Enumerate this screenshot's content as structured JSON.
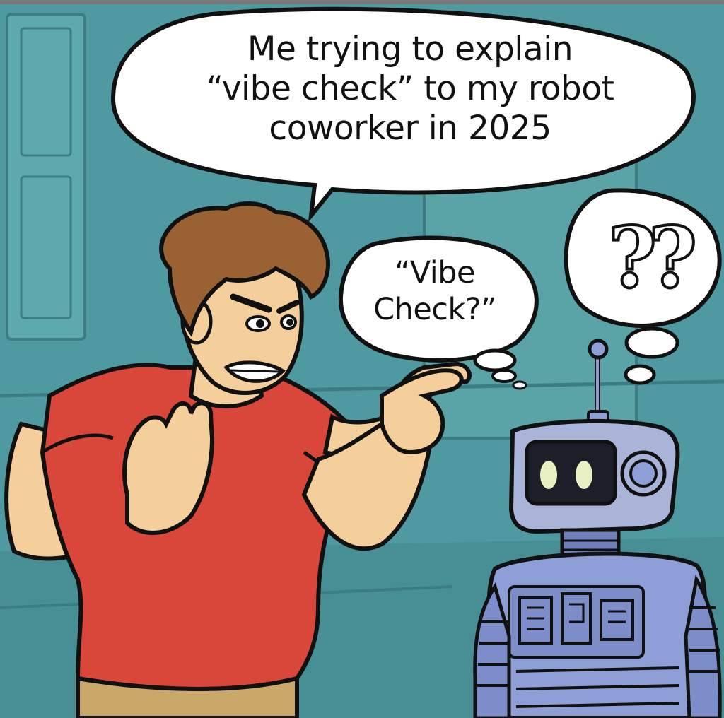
{
  "caption": {
    "lines": [
      "Me trying to explain",
      "“vibe check” to my robot",
      "coworker in 2025"
    ]
  },
  "human_speech": {
    "lines": [
      "“Vibe",
      "Check?”"
    ]
  },
  "robot_thought": {
    "text": "??"
  },
  "colors": {
    "background": "#4f9aa0",
    "wall_panel": "#5ea9ad",
    "shirt": "#d8473a",
    "skin": "#f4cf9c",
    "hair": "#9a6232",
    "pants": "#c9a86a",
    "robot_body": "#8e9ed6",
    "robot_head": "#a9b4d8",
    "robot_eyes": "#e8f0c2",
    "outline": "#111111",
    "bubble_fill": "#ffffff"
  }
}
